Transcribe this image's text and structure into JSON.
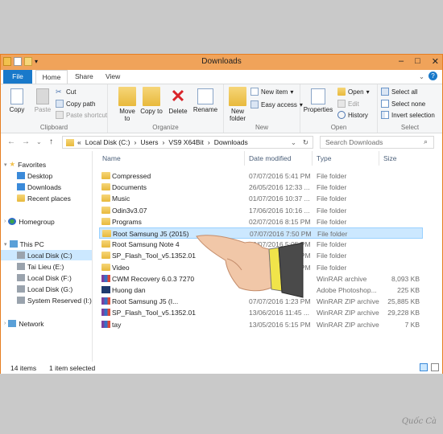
{
  "window": {
    "title": "Downloads"
  },
  "ribbon_tabs": [
    "File",
    "Home",
    "Share",
    "View"
  ],
  "ribbon": {
    "clipboard": {
      "copy": "Copy",
      "paste": "Paste",
      "cut": "Cut",
      "copy_path": "Copy path",
      "paste_shortcut": "Paste shortcut",
      "label": "Clipboard"
    },
    "organize": {
      "move_to": "Move to",
      "copy_to": "Copy to",
      "delete": "Delete",
      "rename": "Rename",
      "label": "Organize"
    },
    "new": {
      "new_folder": "New folder",
      "new_item": "New item",
      "easy_access": "Easy access",
      "label": "New"
    },
    "open": {
      "properties": "Properties",
      "open": "Open",
      "edit": "Edit",
      "history": "History",
      "label": "Open"
    },
    "select": {
      "select_all": "Select all",
      "select_none": "Select none",
      "invert": "Invert selection",
      "label": "Select"
    }
  },
  "address": {
    "crumbs": [
      "«",
      "Local Disk (C:)",
      "Users",
      "VS9 X64Bit",
      "Downloads"
    ],
    "search_placeholder": "Search Downloads"
  },
  "nav": {
    "favorites": "Favorites",
    "desktop": "Desktop",
    "downloads": "Downloads",
    "recent": "Recent places",
    "homegroup": "Homegroup",
    "thispc": "This PC",
    "c": "Local Disk (C:)",
    "e": "Tai Lieu (E:)",
    "f": "Local Disk (F:)",
    "g": "Local Disk (G:)",
    "sysres": "System Reserved (I:)",
    "network": "Network"
  },
  "columns": {
    "name": "Name",
    "date": "Date modified",
    "type": "Type",
    "size": "Size"
  },
  "files": [
    {
      "name": "Compressed",
      "date": "07/07/2016 5:41 PM",
      "type": "File folder",
      "size": "",
      "kind": "folder"
    },
    {
      "name": "Documents",
      "date": "26/05/2016 12:33 ...",
      "type": "File folder",
      "size": "",
      "kind": "folder"
    },
    {
      "name": "Music",
      "date": "01/07/2016 10:37 ...",
      "type": "File folder",
      "size": "",
      "kind": "folder"
    },
    {
      "name": "Odin3v3.07",
      "date": "17/06/2016 10:16 ...",
      "type": "File folder",
      "size": "",
      "kind": "folder"
    },
    {
      "name": "Programs",
      "date": "02/07/2016 8:15 PM",
      "type": "File folder",
      "size": "",
      "kind": "folder"
    },
    {
      "name": "Root Samsung J5 (2015)",
      "date": "07/07/2016 7:50 PM",
      "type": "File folder",
      "size": "",
      "kind": "folder"
    },
    {
      "name": "Root Samsung Note 4",
      "date": "06/07/2016 5:05 PM",
      "type": "File folder",
      "size": "",
      "kind": "folder"
    },
    {
      "name": "SP_Flash_Tool_v5.1352.01",
      "date": "07/07/2016 5:06 PM",
      "type": "File folder",
      "size": "",
      "kind": "folder"
    },
    {
      "name": "Video",
      "date": "07/07/2016 5:54 PM",
      "type": "File folder",
      "size": "",
      "kind": "folder"
    },
    {
      "name": "CWM Recovery 6.0.3 7270",
      "date": "",
      "type": "WinRAR archive",
      "size": "8,093 KB",
      "kind": "rar"
    },
    {
      "name": "Huong dan",
      "date": "",
      "type": "Adobe Photoshop...",
      "size": "225 KB",
      "kind": "psd"
    },
    {
      "name": "Root Samsung J5 (I...",
      "date": "07/07/2016 1:23 PM",
      "type": "WinRAR ZIP archive",
      "size": "25,885 KB",
      "kind": "rar"
    },
    {
      "name": "SP_Flash_Tool_v5.1352.01",
      "date": "13/06/2016 11:45 ...",
      "type": "WinRAR ZIP archive",
      "size": "29,228 KB",
      "kind": "rar"
    },
    {
      "name": "tay",
      "date": "13/05/2016 5:15 PM",
      "type": "WinRAR ZIP archive",
      "size": "7 KB",
      "kind": "rar"
    }
  ],
  "status": {
    "count": "14 items",
    "selected": "1 item selected"
  },
  "signature": "Quốc Cà"
}
